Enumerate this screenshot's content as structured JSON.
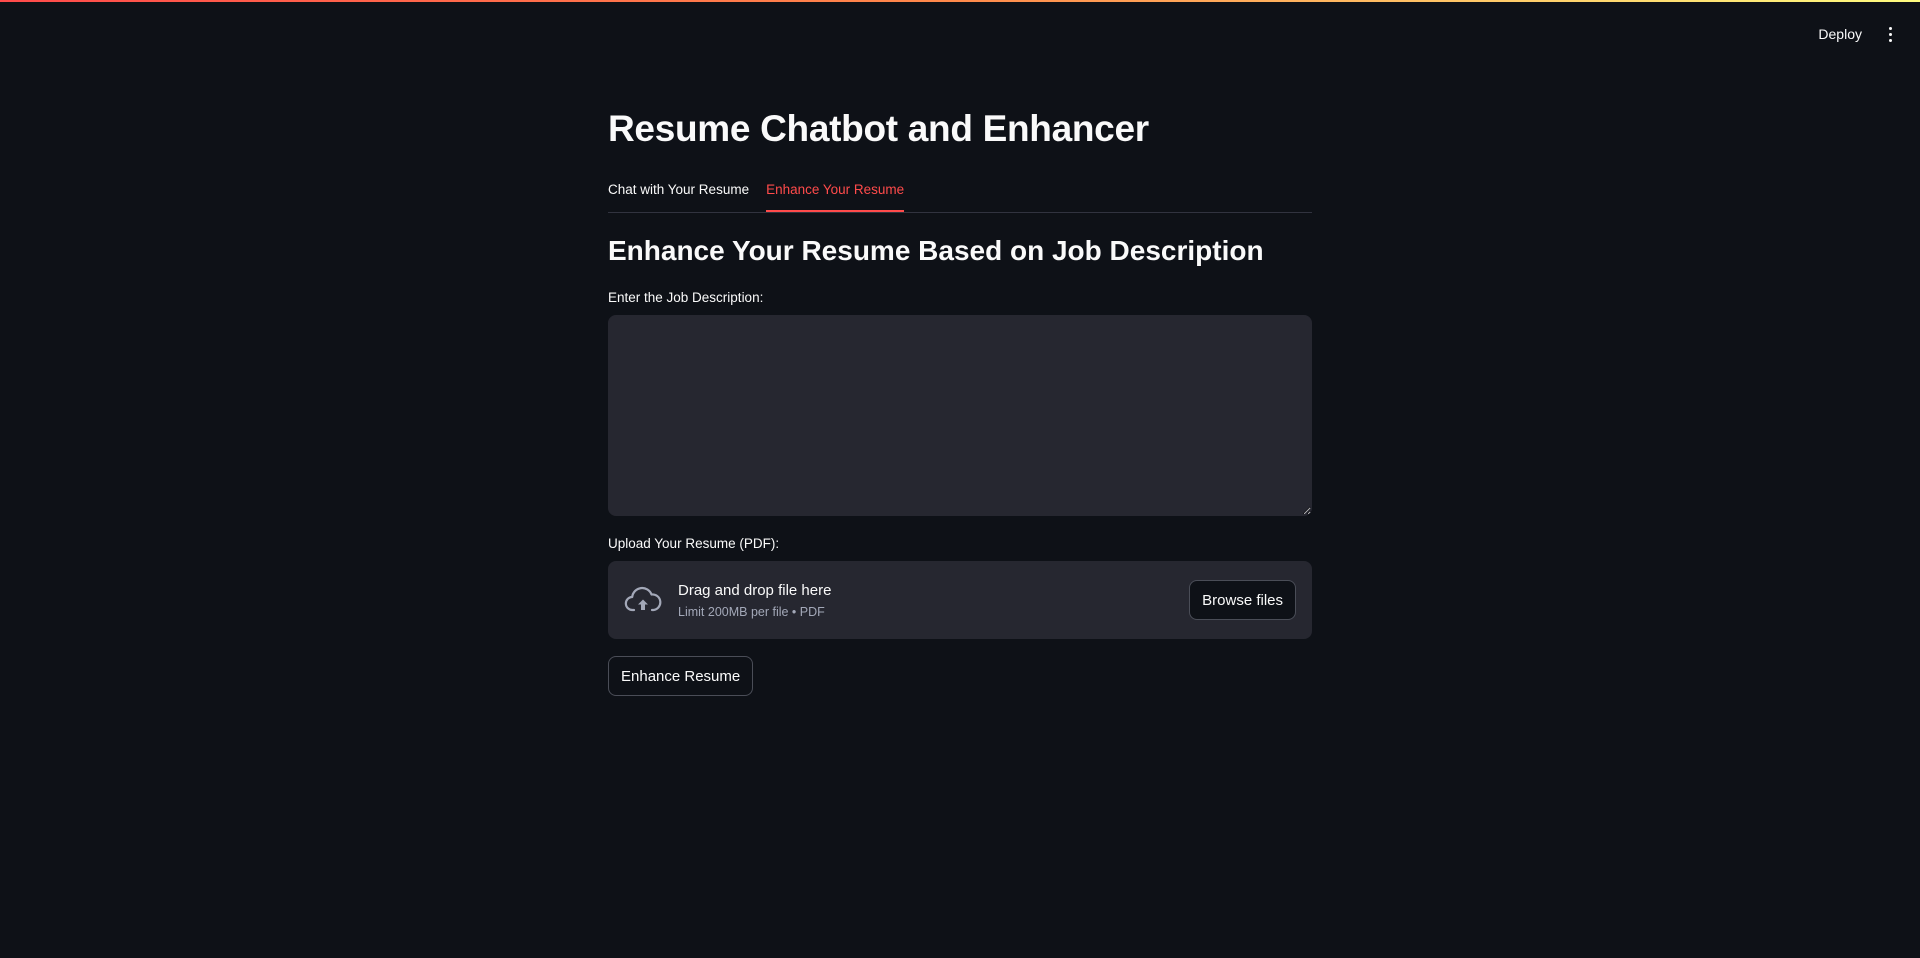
{
  "header": {
    "deploy_label": "Deploy",
    "menu_icon": "more-vertical-icon"
  },
  "main": {
    "title": "Resume Chatbot and Enhancer",
    "tabs": [
      {
        "label": "Chat with Your Resume",
        "active": false
      },
      {
        "label": "Enhance Your Resume",
        "active": true
      }
    ],
    "section_heading": "Enhance Your Resume Based on Job Description",
    "job_description": {
      "label": "Enter the Job Description:",
      "value": ""
    },
    "upload": {
      "label": "Upload Your Resume (PDF):",
      "drop_title": "Drag and drop file here",
      "drop_subtitle": "Limit 200MB per file • PDF",
      "browse_label": "Browse files",
      "icon": "cloud-upload-icon"
    },
    "enhance_button_label": "Enhance Resume"
  },
  "colors": {
    "background": "#0e1117",
    "accent": "#ff4b4b",
    "input_background": "#262730"
  }
}
